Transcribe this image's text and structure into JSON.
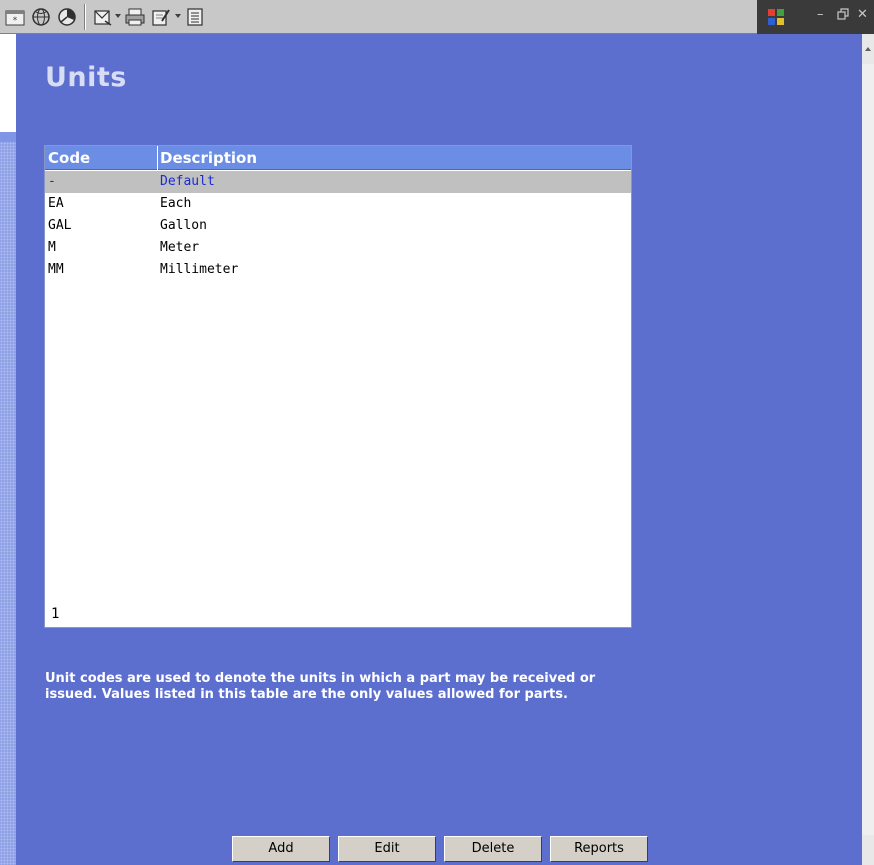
{
  "toolbar": {
    "icons": [
      "new-document-icon",
      "globe-icon",
      "chart-icon",
      "mail-icon",
      "print-icon",
      "edit-icon",
      "notes-icon"
    ],
    "window_controls": {
      "minimize": "–",
      "restore": "🗗",
      "close": "✕"
    }
  },
  "page": {
    "title": "Units"
  },
  "table": {
    "headers": {
      "code": "Code",
      "description": "Description"
    },
    "rows": [
      {
        "code": "-",
        "description": "Default",
        "selected": true
      },
      {
        "code": "EA",
        "description": "Each",
        "selected": false
      },
      {
        "code": "GAL",
        "description": "Gallon",
        "selected": false
      },
      {
        "code": "M",
        "description": "Meter",
        "selected": false
      },
      {
        "code": "MM",
        "description": "Millimeter",
        "selected": false
      }
    ],
    "page_count": "1"
  },
  "note": "Unit codes are used to denote the units in which a part may be received or issued. Values listed in this table are the only values allowed for parts.",
  "buttons": {
    "add": "Add",
    "edit": "Edit",
    "delete": "Delete",
    "reports": "Reports"
  },
  "colors": {
    "background": "#5c6fcf",
    "header": "#6c8de4",
    "selected_row": "#c0c0c0",
    "selected_text": "#1a2cd0"
  }
}
